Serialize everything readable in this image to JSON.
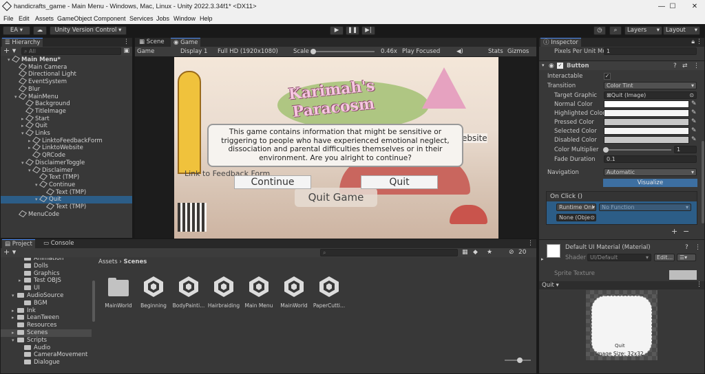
{
  "window": {
    "title": "handicrafts_game - Main Menu - Windows, Mac, Linux - Unity 2022.3.34f1* <DX11>",
    "minimize": "—",
    "maximize": "☐",
    "close": "✕"
  },
  "menu": [
    "File",
    "Edit",
    "Assets",
    "GameObject",
    "Component",
    "Services",
    "Jobs",
    "Window",
    "Help"
  ],
  "toolbar": {
    "account": "EA ▾",
    "version_control": "Unity Version Control ▾",
    "layers": "Layers",
    "layout": "Layout"
  },
  "hierarchy": {
    "tab": "Hierarchy",
    "search_placeholder": "All",
    "items": [
      {
        "label": "Main Menu*",
        "depth": 0,
        "type": "scene"
      },
      {
        "label": "Main Camera",
        "depth": 1
      },
      {
        "label": "Directional Light",
        "depth": 1
      },
      {
        "label": "EventSystem",
        "depth": 1
      },
      {
        "label": "Blur",
        "depth": 1
      },
      {
        "label": "MainMenu",
        "depth": 1,
        "arrow": "▾"
      },
      {
        "label": "Background",
        "depth": 2
      },
      {
        "label": "TitleImage",
        "depth": 2
      },
      {
        "label": "Start",
        "depth": 2,
        "arrow": "▸"
      },
      {
        "label": "Quit",
        "depth": 2,
        "arrow": "▸"
      },
      {
        "label": "Links",
        "depth": 2,
        "arrow": "▾"
      },
      {
        "label": "LinktoFeedbackForm",
        "depth": 3,
        "arrow": "▸"
      },
      {
        "label": "LinktoWebsite",
        "depth": 3,
        "arrow": "▸"
      },
      {
        "label": "QRCode",
        "depth": 3
      },
      {
        "label": "DisclaimerToggle",
        "depth": 2,
        "arrow": "▾"
      },
      {
        "label": "Disclaimer",
        "depth": 3,
        "arrow": "▾"
      },
      {
        "label": "Text (TMP)",
        "depth": 4
      },
      {
        "label": "Continue",
        "depth": 4,
        "arrow": "▾"
      },
      {
        "label": "Text (TMP)",
        "depth": 5
      },
      {
        "label": "Quit",
        "depth": 4,
        "arrow": "▾",
        "selected": true
      },
      {
        "label": "Text (TMP)",
        "depth": 5
      },
      {
        "label": "MenuCode",
        "depth": 1
      }
    ]
  },
  "scene_tabs": {
    "scene": "Scene",
    "game": "Game"
  },
  "game_bar": {
    "mode": "Game",
    "display": "Display 1",
    "resolution": "Full HD (1920x1080)",
    "scale_label": "Scale",
    "scale_value": "0.46x",
    "play_focused": "Play Focused",
    "stats": "Stats",
    "gizmos": "Gizmos"
  },
  "game_view": {
    "title_logo": "Karimah's Paracosm",
    "disclaimer": "This game contains information that might be sensitive or triggering to people who have experienced emotional neglect, dissociation and parental difficulties themselves or in their environment. Are you alright to continue?",
    "continue": "Continue",
    "quit": "Quit",
    "quit_game": "Quit Game",
    "link_feedback": "Link to Feedback Form",
    "link_website": "ebsite"
  },
  "project": {
    "tab_project": "Project",
    "tab_console": "Console",
    "tree": [
      {
        "label": "Animation",
        "depth": 2
      },
      {
        "label": "Dolls",
        "depth": 2
      },
      {
        "label": "Graphics",
        "depth": 2
      },
      {
        "label": "Test OBJS",
        "depth": 2,
        "arrow": "▸"
      },
      {
        "label": "UI",
        "depth": 2
      },
      {
        "label": "AudioSource",
        "depth": 1,
        "arrow": "▾"
      },
      {
        "label": "BGM",
        "depth": 2
      },
      {
        "label": "Ink",
        "depth": 1,
        "arrow": "▸"
      },
      {
        "label": "LeanTween",
        "depth": 1,
        "arrow": "▸"
      },
      {
        "label": "Resources",
        "depth": 1
      },
      {
        "label": "Scenes",
        "depth": 1,
        "arrow": "▸",
        "selected": true
      },
      {
        "label": "Scripts",
        "depth": 1,
        "arrow": "▾"
      },
      {
        "label": "Audio",
        "depth": 2
      },
      {
        "label": "CameraMovement",
        "depth": 2
      },
      {
        "label": "Dialogue",
        "depth": 2
      }
    ],
    "breadcrumb": [
      "Assets",
      "Scenes"
    ],
    "visible_count": "20",
    "assets": [
      {
        "label": "MainWorld",
        "kind": "folder"
      },
      {
        "label": "Beginning",
        "kind": "unity"
      },
      {
        "label": "BodyPainti...",
        "kind": "unity"
      },
      {
        "label": "Hairbraiding",
        "kind": "unity"
      },
      {
        "label": "Main Menu",
        "kind": "unity"
      },
      {
        "label": "MainWorld",
        "kind": "unity"
      },
      {
        "label": "PaperCutti...",
        "kind": "unity"
      }
    ]
  },
  "inspector": {
    "tab": "Inspector",
    "pixels_per_unit_label": "Pixels Per Unit Mu",
    "pixels_per_unit_value": "1",
    "component": "Button",
    "interactable_label": "Interactable",
    "transition_label": "Transition",
    "transition_value": "Color Tint",
    "target_graphic_label": "Target Graphic",
    "target_graphic_value": "Quit (Image)",
    "colors": [
      {
        "label": "Normal Color",
        "hex": "#FFFFFF"
      },
      {
        "label": "Highlighted Color",
        "hex": "#F5F5F5"
      },
      {
        "label": "Pressed Color",
        "hex": "#C8C8C8"
      },
      {
        "label": "Selected Color",
        "hex": "#F5F5F5"
      },
      {
        "label": "Disabled Color",
        "hex": "#C8C8C8"
      }
    ],
    "color_multiplier_label": "Color Multiplier",
    "color_multiplier_value": "1",
    "fade_duration_label": "Fade Duration",
    "fade_duration_value": "0.1",
    "navigation_label": "Navigation",
    "navigation_value": "Automatic",
    "visualize": "Visualize",
    "onclick_label": "On Click ()",
    "runtime": "Runtime Onl",
    "no_function": "No Function",
    "none_object": "None (Obje",
    "material_name": "Default UI Material (Material)",
    "shader_label": "Shader",
    "shader_value": "UI/Default",
    "edit": "Edit...",
    "sprite_texture": "Sprite Texture",
    "preview_name": "Quit ▾",
    "preview_caption": "Quit",
    "image_size": "Image Size: 32x32"
  }
}
